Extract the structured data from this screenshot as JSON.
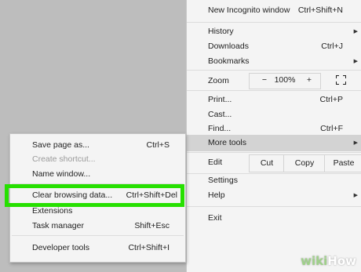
{
  "main_menu": {
    "new_incognito": {
      "label": "New Incognito window",
      "shortcut": "Ctrl+Shift+N"
    },
    "history": {
      "label": "History"
    },
    "downloads": {
      "label": "Downloads",
      "shortcut": "Ctrl+J"
    },
    "bookmarks": {
      "label": "Bookmarks"
    },
    "zoom": {
      "label": "Zoom",
      "minus": "−",
      "value": "100%",
      "plus": "+"
    },
    "print": {
      "label": "Print...",
      "shortcut": "Ctrl+P"
    },
    "cast": {
      "label": "Cast..."
    },
    "find": {
      "label": "Find...",
      "shortcut": "Ctrl+F"
    },
    "more_tools": {
      "label": "More tools"
    },
    "edit": {
      "label": "Edit",
      "cut": "Cut",
      "copy": "Copy",
      "paste": "Paste"
    },
    "settings": {
      "label": "Settings"
    },
    "help": {
      "label": "Help"
    },
    "exit": {
      "label": "Exit"
    }
  },
  "sub_menu": {
    "save_page": {
      "label": "Save page as...",
      "shortcut": "Ctrl+S"
    },
    "create_shortcut": {
      "label": "Create shortcut..."
    },
    "name_window": {
      "label": "Name window..."
    },
    "clear_browsing": {
      "label": "Clear browsing data...",
      "shortcut": "Ctrl+Shift+Del"
    },
    "extensions": {
      "label": "Extensions"
    },
    "task_manager": {
      "label": "Task manager",
      "shortcut": "Shift+Esc"
    },
    "developer_tools": {
      "label": "Developer tools",
      "shortcut": "Ctrl+Shift+I"
    }
  },
  "watermark": {
    "part1": "wiki",
    "part2": "How"
  },
  "colors": {
    "highlight": "#26e000",
    "menu_bg": "#f4f4f4",
    "hover": "#d3d3d3"
  }
}
